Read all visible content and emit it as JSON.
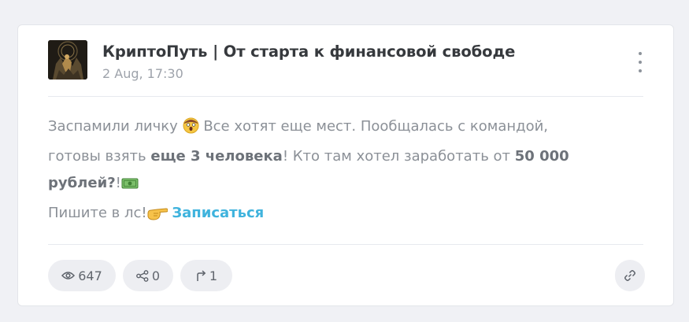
{
  "post": {
    "channel_title": "КриптоПуть | От старта к финансовой свободе",
    "date": "2 Aug, 17:30",
    "avatar_icon": "channel-avatar",
    "body": {
      "line1_text": "Заспамили личку",
      "line1_rest": "Все хотят еще мест. Пообщалась с командой,",
      "line2_text": "готовы взять",
      "line2_bold": "еще 3 человека",
      "line2_rest": "! Кто там хотел заработать от",
      "line2_bold2": "50 000",
      "line3_bold": "рублей?",
      "line3_rest": "!",
      "line4_text": "Пишите в лс!",
      "cta_link": "Записаться"
    },
    "stats": {
      "views": "647",
      "shares": "0",
      "forwards": "1"
    },
    "icons": {
      "menu": "kebab-menu-icon",
      "views": "eye-icon",
      "shares": "share-icon",
      "forwards": "forward-arrow-icon",
      "copy_link": "link-icon"
    },
    "colors": {
      "link": "#3fb3dd",
      "title": "#36393d",
      "text": "#8b9097"
    }
  }
}
